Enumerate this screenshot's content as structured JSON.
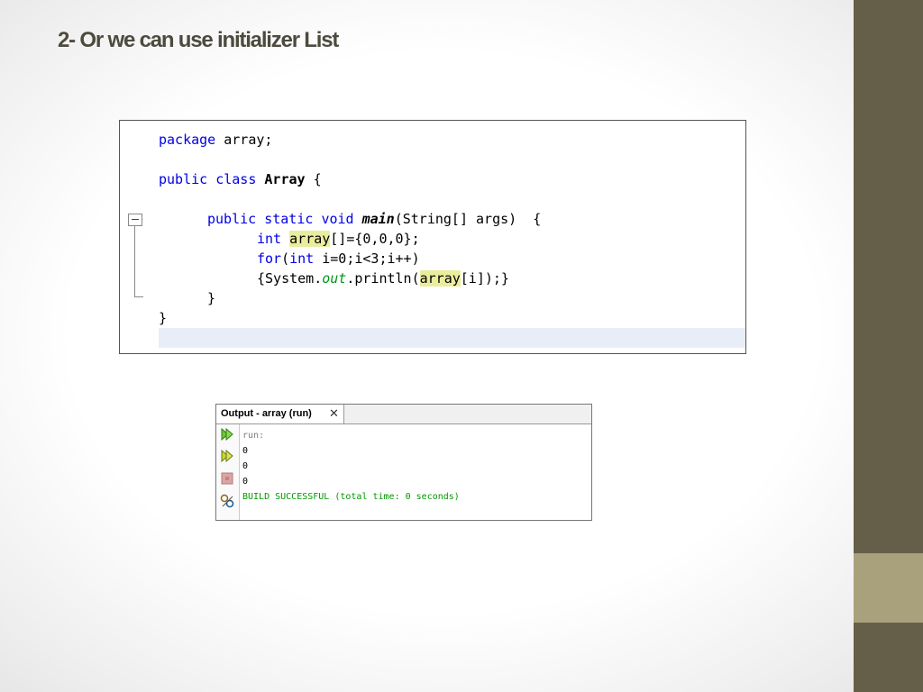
{
  "slide": {
    "title": "2- Or we can use initializer List",
    "colors": {
      "sidebar": "#655e48",
      "sidebar_accent": "#a8a17c",
      "title": "#4d4a3e"
    }
  },
  "code": {
    "line1": {
      "kw": "package",
      "rest": " array;"
    },
    "line2": {
      "kw1": "public",
      "kw2": "class",
      "name": "Array",
      "rest": " {"
    },
    "line3": {
      "kw1": "public",
      "kw2": "static",
      "kw3": "void",
      "method": "main",
      "rest": "(String[] args)  {"
    },
    "line4": {
      "kw": "int",
      "var": "array",
      "rest": "[]={0,0,0};"
    },
    "line5": {
      "kw1": "for",
      "open": "(",
      "kw2": "int",
      "rest": " i=0;i<3;i++)"
    },
    "line6": {
      "pre": "{System.",
      "field": "out",
      "mid": ".println(",
      "var": "array",
      "rest": "[i]);}"
    },
    "line7": "}",
    "line8": "}"
  },
  "output": {
    "tab_label": "Output - array (run)",
    "close_glyph": "✕",
    "lines": [
      "run:",
      "0",
      "0",
      "0",
      "BUILD SUCCESSFUL (total time: 0 seconds)"
    ],
    "colors": {
      "run": "#808080",
      "value": "#000000",
      "success": "#009900"
    },
    "icons": [
      "rerun-icon",
      "rerun-different-icon",
      "stop-icon",
      "settings-icon"
    ]
  }
}
